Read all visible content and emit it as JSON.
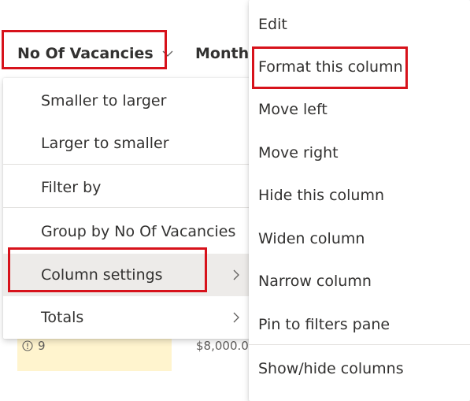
{
  "header": {
    "column_title": "No Of Vacancies",
    "next_column_title": "Month"
  },
  "row": {
    "count": "9",
    "amount": "$8,000.0"
  },
  "sort_menu": {
    "items": [
      {
        "label": "Smaller to larger"
      },
      {
        "label": "Larger to smaller"
      },
      {
        "label": "Filter by"
      },
      {
        "label": "Group by No Of Vacancies"
      },
      {
        "label": "Column settings",
        "has_submenu": true,
        "active": true
      },
      {
        "label": "Totals",
        "has_submenu": true
      }
    ]
  },
  "settings_menu": {
    "items": [
      {
        "label": "Edit"
      },
      {
        "label": "Format this column"
      },
      {
        "label": "Move left"
      },
      {
        "label": "Move right"
      },
      {
        "label": "Hide this column"
      },
      {
        "label": "Widen column"
      },
      {
        "label": "Narrow column"
      },
      {
        "label": "Pin to filters pane"
      },
      {
        "label": "Show/hide columns"
      }
    ]
  },
  "icons": {
    "header_dropdown": "chevron-down-icon",
    "submenu": "chevron-right-icon",
    "row_status": "info-circle-icon"
  },
  "colors": {
    "highlight": "#d7121b",
    "active_item_bg": "#edebe9",
    "cell_bg": "#fff4ce",
    "text": "#323130"
  }
}
